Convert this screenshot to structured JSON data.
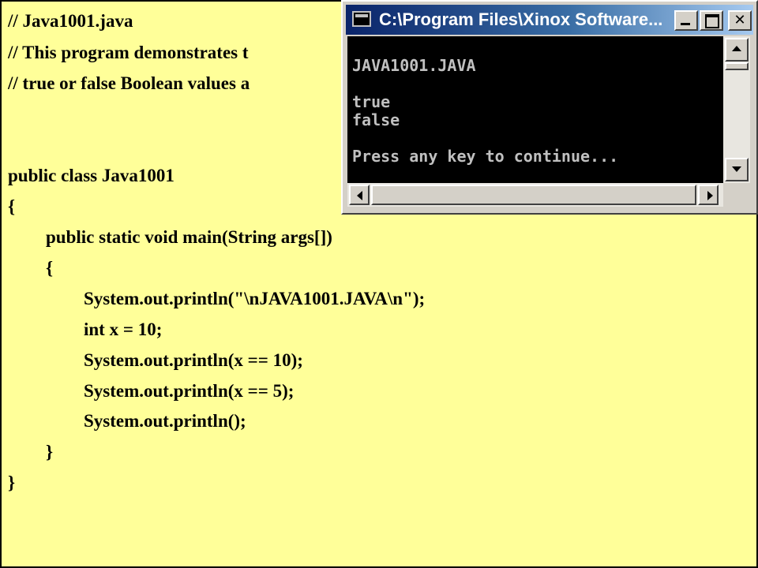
{
  "source": {
    "lines": [
      "// Java1001.java",
      "// This program demonstrates t",
      "// true or false Boolean values a",
      "public class Java1001",
      "{",
      "public static void main(String args[])",
      "{",
      "System.out.println(\"\\nJAVA1001.JAVA\\n\");",
      "int x = 10;",
      "System.out.println(x == 10);",
      "System.out.println(x == 5);",
      "System.out.println();",
      "}",
      "}"
    ]
  },
  "console": {
    "title": "C:\\Program Files\\Xinox Software...",
    "buttons": {
      "minimize": "_",
      "maximize": "□",
      "close": "✕"
    },
    "icon": "console-window-icon",
    "output": [
      "JAVA1001.JAVA",
      "true",
      "false",
      "Press any key to continue..."
    ]
  },
  "colors": {
    "slide_background": "#ffff99",
    "console_background": "#000000",
    "console_text": "#c0c0c0",
    "titlebar_start": "#0a246a",
    "titlebar_end": "#a6caf0"
  }
}
